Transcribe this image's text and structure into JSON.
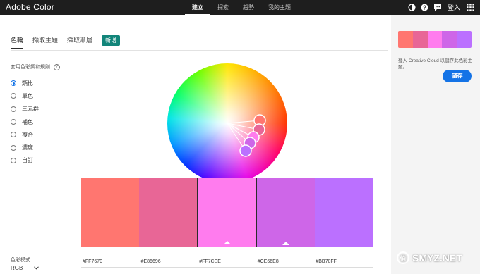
{
  "header": {
    "app_title": "Adobe Color",
    "nav": [
      "建立",
      "探索",
      "趨勢",
      "我的主題"
    ],
    "login_label": "登入",
    "icons": [
      "theme-mode-icon",
      "help-icon",
      "feedback-icon",
      "apps-grid-icon"
    ]
  },
  "tabs": {
    "items": [
      "色輪",
      "擷取主題",
      "擷取漸層"
    ],
    "badge": "新增"
  },
  "rules": {
    "label": "套用色彩調和規則",
    "help_icon": "help-icon",
    "items": [
      "類比",
      "單色",
      "三元群",
      "補色",
      "複合",
      "濃度",
      "自訂"
    ],
    "selected": "類比"
  },
  "color_mode": {
    "label": "色彩模式",
    "value": "RGB"
  },
  "swatches": [
    {
      "hex": "#FF7670",
      "color": "#ff7670"
    },
    {
      "hex": "#E86696",
      "color": "#e86696"
    },
    {
      "hex": "#FF7CEE",
      "color": "#ff7cee"
    },
    {
      "hex": "#CE66E8",
      "color": "#ce66e8"
    },
    {
      "hex": "#BB70FF",
      "color": "#bb70ff"
    }
  ],
  "selected_swatch": "#FF7CEE",
  "right_panel": {
    "save_text": "登入 Creative Cloud 以儲存此色彩主題。",
    "save_button": "儲存"
  },
  "watermark": {
    "text": "SMYZ.NET",
    "symbol": "值"
  }
}
